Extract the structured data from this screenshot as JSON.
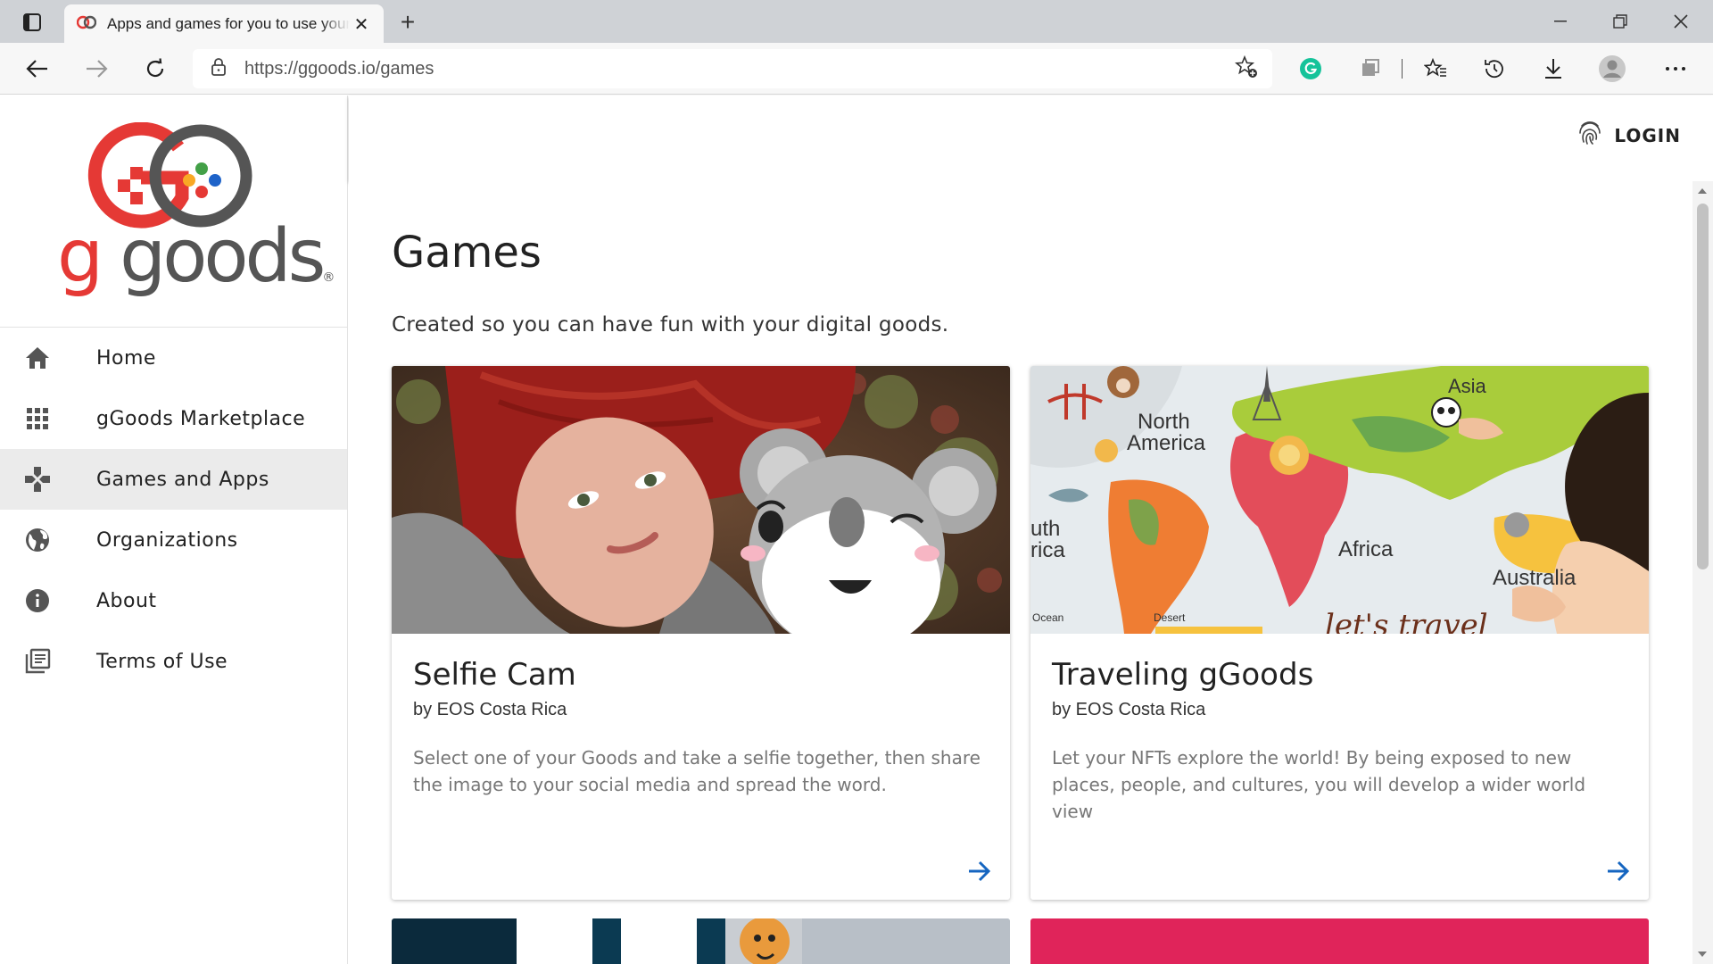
{
  "browser": {
    "tab_title": "Apps and games for you to use your Goods",
    "url": "https://ggoods.io/games",
    "window_controls": [
      "minimize-icon",
      "restore-icon",
      "close-icon"
    ],
    "toolbar_icons": [
      "grammarly-icon",
      "extensions-icon",
      "favorites-icon",
      "history-icon",
      "downloads-icon",
      "profile-icon",
      "more-icon"
    ]
  },
  "sidebar": {
    "logo_text_g": "g",
    "logo_text_rest": "goods",
    "logo_registered": "®",
    "items": [
      {
        "label": "Home",
        "icon": "home-icon",
        "active": false
      },
      {
        "label": "gGoods Marketplace",
        "icon": "apps-grid-icon",
        "active": false
      },
      {
        "label": "Games and Apps",
        "icon": "gamepad-icon",
        "active": true
      },
      {
        "label": "Organizations",
        "icon": "globe-icon",
        "active": false
      },
      {
        "label": "About",
        "icon": "info-icon",
        "active": false
      },
      {
        "label": "Terms of Use",
        "icon": "library-books-icon",
        "active": false
      }
    ]
  },
  "header": {
    "login_label": "LOGIN"
  },
  "main": {
    "title": "Games",
    "subtitle": "Created so you can have fun with your digital goods.",
    "cards": [
      {
        "title": "Selfie Cam",
        "author": "by EOS Costa Rica",
        "description": "Select one of your Goods and take a selfie together, then share the image to your social media and spread the word."
      },
      {
        "title": "Traveling gGoods",
        "author": "by EOS Costa Rica",
        "description": "Let your NFTs explore the world! By being exposed to new places, people, and cultures, you will develop a wider world view",
        "map_labels": {
          "north_america": "North\nAmerica",
          "south_america": "uth\nrica",
          "africa": "Africa",
          "asia": "Asia",
          "australia": "Australia",
          "ocean": "Ocean",
          "desert": "Desert",
          "banner": "let's travel"
        }
      }
    ]
  },
  "colors": {
    "accent_blue": "#1565c0",
    "brand_red": "#e53935",
    "brand_gray": "#555555",
    "active_nav_bg": "#ebebeb"
  }
}
